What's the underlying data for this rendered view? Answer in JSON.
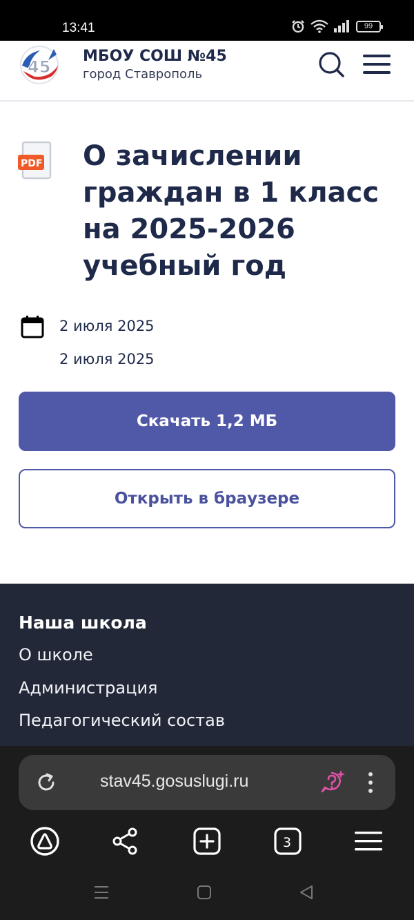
{
  "status_bar": {
    "time": "13:41",
    "battery": "99"
  },
  "header": {
    "school_name": "МБОУ СОШ №45",
    "city": "город Ставрополь",
    "logo_text": "45"
  },
  "document": {
    "file_type": "PDF",
    "title": "О зачислении граждан в 1 класс на 2025-2026 учебный год",
    "date_created": "2 июля 2025",
    "date_updated": "2 июля 2025"
  },
  "actions": {
    "download_label": "Скачать 1,2 МБ",
    "open_label": "Открыть в браузере"
  },
  "footer": {
    "heading": "Наша школа",
    "links": [
      "О школе",
      "Администрация",
      "Педагогический состав"
    ]
  },
  "browser": {
    "url": "stav45.gosuslugi.ru",
    "tabs_count": "3"
  },
  "colors": {
    "primary": "#5058a8",
    "dark_footer": "#222837",
    "pdf_badge": "#f05a28",
    "title_text": "#1f2a4a"
  }
}
